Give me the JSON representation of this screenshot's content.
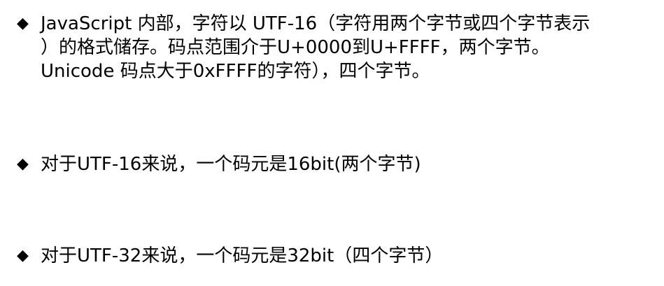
{
  "bullet_symbol": "◆",
  "bullets": [
    {
      "text": "JavaScript 内部，字符以 UTF-16（字符用两个字节或四个字节表示\n）的格式储存。码点范围介于U+0000到U+FFFF，两个字节。\nUnicode 码点大于0xFFFF的字符），四个字节。"
    },
    {
      "text": "对于UTF-16来说，一个码元是16bit(两个字节)"
    },
    {
      "text": "对于UTF-32来说，一个码元是32bit（四个字节）"
    }
  ]
}
